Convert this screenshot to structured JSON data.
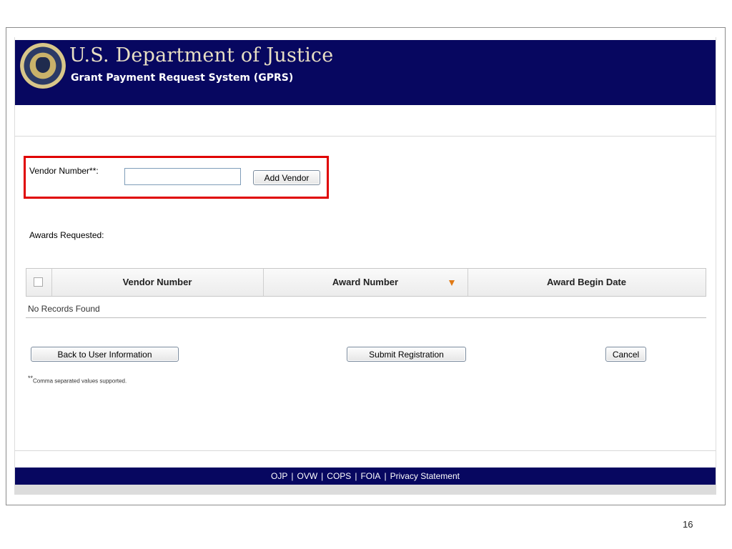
{
  "header": {
    "title": "U.S. Department of Justice",
    "subtitle": "Grant Payment Request System (GPRS)"
  },
  "vendor": {
    "label": "Vendor Number**:",
    "input_value": "",
    "add_button": "Add Vendor"
  },
  "awards": {
    "label": "Awards Requested:",
    "columns": [
      "Vendor Number",
      "Award Number",
      "Award Begin Date"
    ],
    "empty_text": "No Records Found"
  },
  "actions": {
    "back": "Back to User Information",
    "submit": "Submit Registration",
    "cancel": "Cancel"
  },
  "footnote": {
    "marker": "**",
    "text": "Comma separated values supported."
  },
  "footer": {
    "links": [
      "OJP",
      "OVW",
      "COPS",
      "FOIA",
      "Privacy Statement"
    ],
    "separator": "|"
  },
  "page_number": "16",
  "colors": {
    "header_bg": "#070760",
    "highlight_border": "#e00000",
    "sort_icon": "#e07a16"
  }
}
